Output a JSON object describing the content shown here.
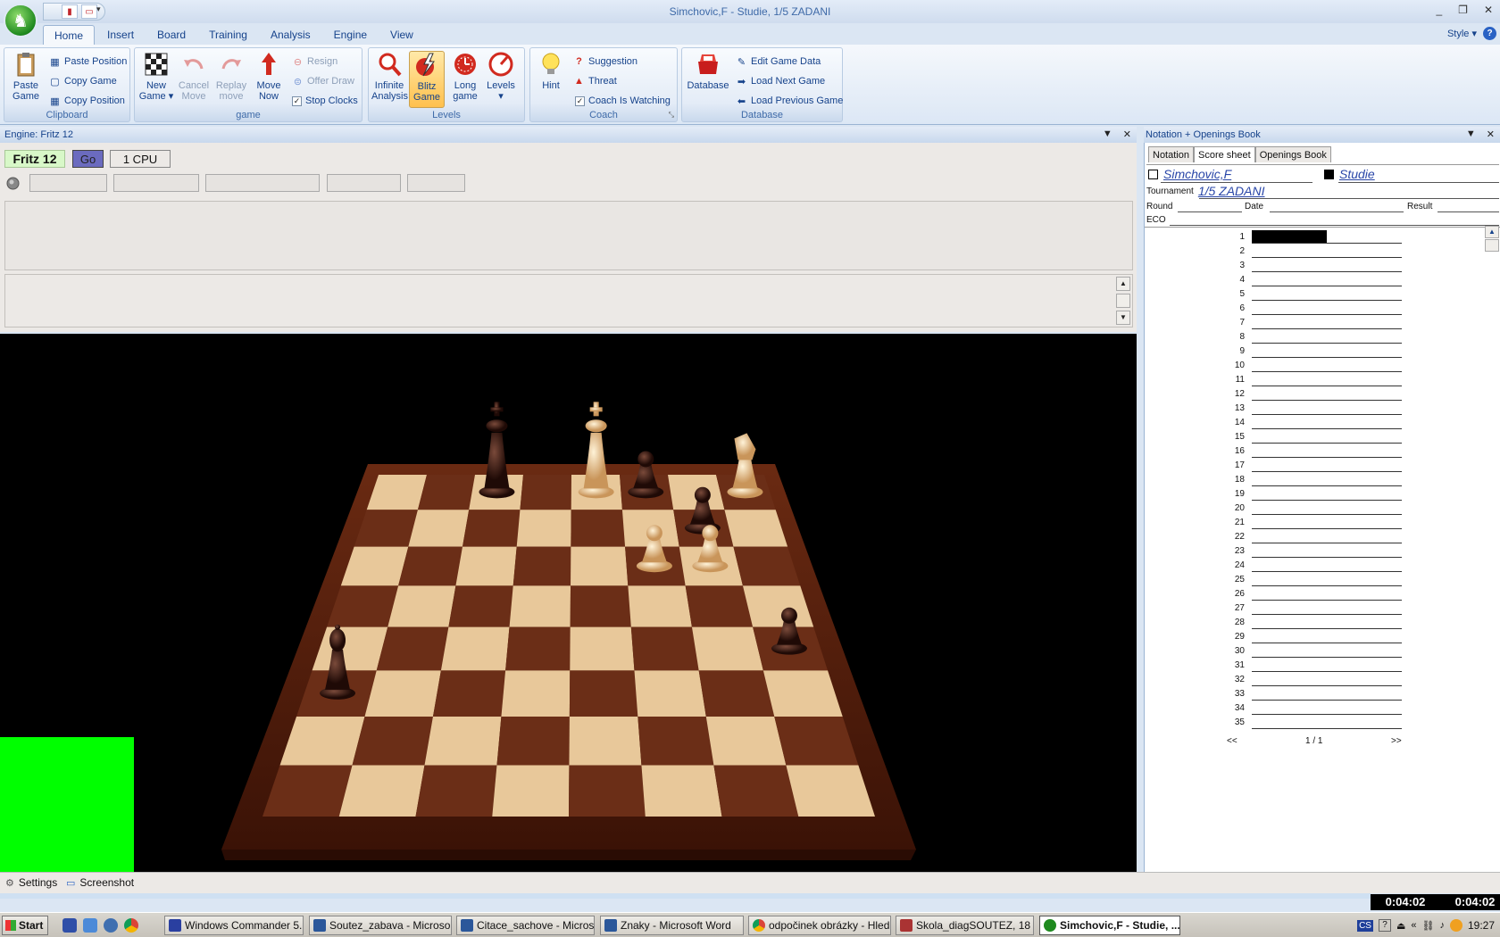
{
  "window": {
    "title": "Simchovic,F - Studie, 1/5 ZADANI",
    "minimize": "_",
    "restore": "❐",
    "close": "✕"
  },
  "app_icon": "fritz-orb-icon",
  "ribbon_tabs": [
    "Home",
    "Insert",
    "Board",
    "Training",
    "Analysis",
    "Engine",
    "View"
  ],
  "style_menu": "Style ▾",
  "ribbon": {
    "clipboard": {
      "label": "Clipboard",
      "paste_game": [
        "Paste",
        "Game"
      ],
      "paste_position": "Paste Position",
      "copy_game": "Copy Game",
      "copy_position": "Copy Position"
    },
    "game": {
      "label": "game",
      "new_game": [
        "New",
        "Game ▾"
      ],
      "cancel_move": [
        "Cancel",
        "Move"
      ],
      "replay_move": [
        "Replay",
        "move"
      ],
      "move_now": [
        "Move",
        "Now"
      ],
      "resign": "Resign",
      "offer_draw": "Offer Draw",
      "stop_clocks": "Stop Clocks"
    },
    "levels": {
      "label": "Levels",
      "infinite_analysis": [
        "Infinite",
        "Analysis"
      ],
      "blitz_game": [
        "Blitz",
        "Game"
      ],
      "long_game": [
        "Long",
        "game"
      ],
      "levels_btn": [
        "Levels",
        "▾"
      ]
    },
    "coach": {
      "label": "Coach",
      "hint": "Hint",
      "suggestion": "Suggestion",
      "threat": "Threat",
      "coach_watching": "Coach Is Watching"
    },
    "database": {
      "label": "Database",
      "database_btn": "Database",
      "edit_game_data": "Edit Game Data",
      "load_next_game": "Load Next Game",
      "load_previous_game": "Load Previous Game"
    }
  },
  "engine_panel": {
    "title": "Engine: Fritz 12",
    "engine_name": "Fritz 12",
    "go_label": "Go",
    "cpu_label": "1 CPU"
  },
  "notation_panel": {
    "title": "Notation + Openings Book",
    "tabs": [
      "Notation",
      "Score sheet",
      "Openings Book"
    ],
    "active_tab": "Score sheet",
    "white_player": "Simchovic,F",
    "black_player": "Studie",
    "tournament_label": "Tournament",
    "tournament": "1/5 ZADANI",
    "round_label": "Round",
    "date_label": "Date",
    "result_label": "Result",
    "eco_label": "ECO",
    "move_numbers": [
      "1",
      "2",
      "3",
      "4",
      "5",
      "6",
      "7",
      "8",
      "9",
      "10",
      "11",
      "12",
      "13",
      "14",
      "15",
      "16",
      "17",
      "18",
      "19",
      "20",
      "21",
      "22",
      "23",
      "24",
      "25",
      "26",
      "27",
      "28",
      "29",
      "30",
      "31",
      "32",
      "33",
      "34",
      "35"
    ],
    "pager_prev": "<<",
    "pager_page": "1 / 1",
    "pager_next": ">>"
  },
  "status_bar": {
    "settings": "Settings",
    "screenshot": "Screenshot"
  },
  "clocks": {
    "white": "0:04:02",
    "black": "0:04:02"
  },
  "board": {
    "pieces": [
      {
        "piece": "king",
        "color": "black",
        "square": "c8"
      },
      {
        "piece": "king",
        "color": "white",
        "square": "e8"
      },
      {
        "piece": "pawn",
        "color": "black",
        "square": "f8"
      },
      {
        "piece": "knight",
        "color": "white",
        "square": "h8"
      },
      {
        "piece": "pawn",
        "color": "black",
        "square": "g7"
      },
      {
        "piece": "pawn",
        "color": "white",
        "square": "f6"
      },
      {
        "piece": "pawn",
        "color": "white",
        "square": "g6"
      },
      {
        "piece": "pawn",
        "color": "black",
        "square": "h4"
      },
      {
        "piece": "bishop",
        "color": "black",
        "square": "a3"
      }
    ]
  },
  "taskbar": {
    "start": "Start",
    "tasks": [
      "Windows Commander 5....",
      "Soutez_zabava - Microso...",
      "Citace_sachove - Micros...",
      "Znaky - Microsoft Word",
      "odpočinek obrázky - Hled...",
      "Skola_diagSOUTEZ,  18 ...",
      "Simchovic,F - Studie, ..."
    ],
    "active_task": "Simchovic,F - Studie, ...",
    "tray_lang": "CS",
    "time": "19:27"
  }
}
